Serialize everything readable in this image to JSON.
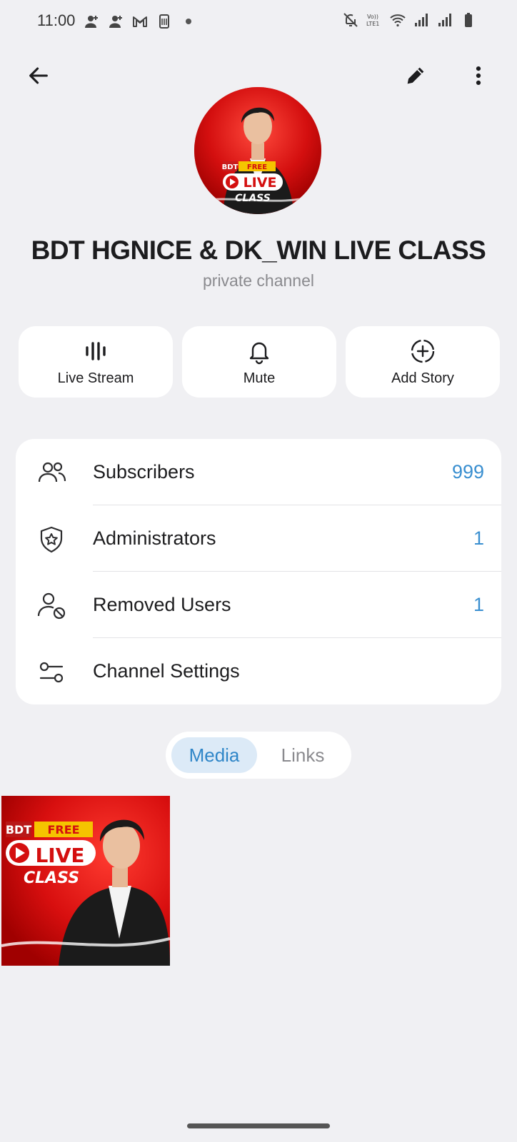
{
  "status_bar": {
    "time": "11:00",
    "left_icons": [
      "person-add-icon",
      "person-add-icon",
      "gmail-icon",
      "sim-icon",
      "dot-icon"
    ],
    "right_icons": [
      "notifications-off-icon",
      "volte-icon",
      "wifi-icon",
      "signal-icon",
      "signal-icon",
      "battery-icon"
    ],
    "volte_label": "Vo)) LTE1"
  },
  "top_bar": {
    "back_icon": "arrow-left-icon",
    "edit_icon": "pencil-icon",
    "more_icon": "more-vert-icon"
  },
  "channel": {
    "title": "BDT HGNICE & DK_WIN LIVE CLASS",
    "subtitle": "private channel",
    "avatar_text": [
      "BDT",
      "FREE",
      "LIVE",
      "CLASS"
    ]
  },
  "actions": [
    {
      "label": "Live Stream",
      "icon": "live-stream-icon"
    },
    {
      "label": "Mute",
      "icon": "bell-icon"
    },
    {
      "label": "Add Story",
      "icon": "add-story-icon"
    }
  ],
  "list": [
    {
      "label": "Subscribers",
      "value": "999",
      "icon": "people-icon"
    },
    {
      "label": "Administrators",
      "value": "1",
      "icon": "shield-star-icon"
    },
    {
      "label": "Removed Users",
      "value": "1",
      "icon": "person-blocked-icon"
    },
    {
      "label": "Channel Settings",
      "value": "",
      "icon": "sliders-icon"
    }
  ],
  "tabs": [
    {
      "label": "Media",
      "active": true
    },
    {
      "label": "Links",
      "active": false
    }
  ],
  "media": {
    "thumb_text": [
      "BDT",
      "FREE",
      "LIVE",
      "CLASS"
    ]
  },
  "colors": {
    "accent": "#3a8fd0",
    "background": "#f0f0f3",
    "brand_red": "#d80f0f"
  }
}
